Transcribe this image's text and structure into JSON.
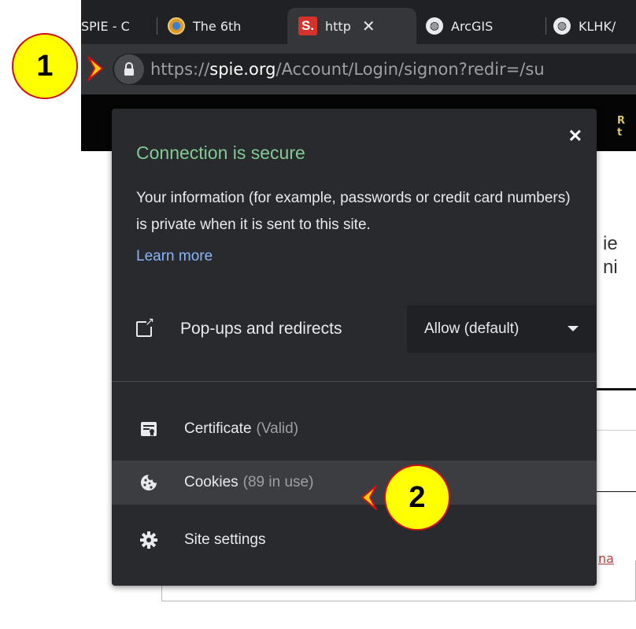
{
  "tabs": [
    {
      "title": "SPIE - C",
      "icon": "globe-icon"
    },
    {
      "title": "The 6th",
      "icon": "site-favicon-icon"
    },
    {
      "title": "http",
      "icon": "spie-favicon-icon",
      "active": true
    },
    {
      "title": "ArcGIS",
      "icon": "globe-icon"
    },
    {
      "title": "KLHK/",
      "icon": "globe-icon"
    }
  ],
  "spie_favicon_text": "S.",
  "close_tab_symbol": "✕",
  "address": {
    "scheme": "https://",
    "host": "spie.org",
    "path": "/Account/Login/signon?redir=/su"
  },
  "popup": {
    "title": "Connection is secure",
    "description": "Your information (for example, passwords or credit card numbers) is private when it is sent to this site.",
    "learn_more": "Learn more",
    "close_symbol": "✕",
    "permission": {
      "label": "Pop-ups and redirects",
      "value": "Allow (default)"
    },
    "items": [
      {
        "label": "Certificate",
        "sub": "(Valid)",
        "icon": "certificate-icon"
      },
      {
        "label": "Cookies",
        "sub": "(89 in use)",
        "icon": "cookie-icon"
      },
      {
        "label": "Site settings",
        "sub": "",
        "icon": "gear-icon"
      }
    ]
  },
  "page_fragments": {
    "text_a": "ie",
    "text_b": "ni",
    "link": "na"
  },
  "callouts": {
    "one": "1",
    "two": "2"
  },
  "colors": {
    "secure_green": "#81c995",
    "link_blue": "#8ab4f8",
    "callout_fill": "#ffff00",
    "callout_border": "#cc1111"
  }
}
